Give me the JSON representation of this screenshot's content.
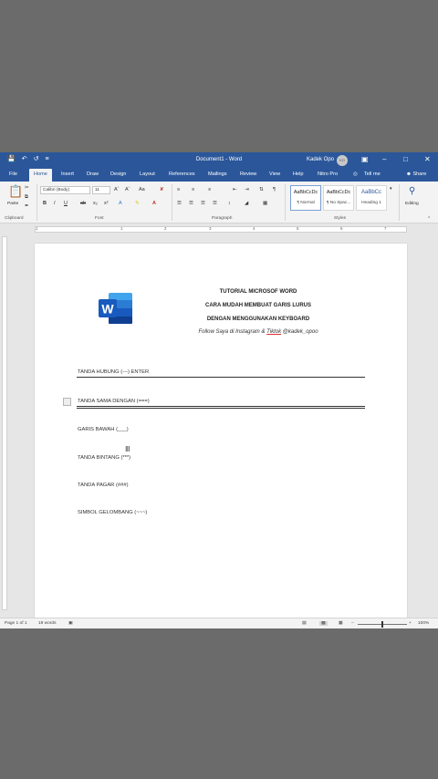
{
  "window": {
    "title": "Document1 - Word",
    "user": "Kadek Opo",
    "avatar_initials": "KO",
    "qa_icons": [
      "save-icon",
      "undo-icon",
      "redo-icon",
      "customize-icon"
    ]
  },
  "tabs": [
    "File",
    "Home",
    "Insert",
    "Draw",
    "Design",
    "Layout",
    "References",
    "Mailings",
    "Review",
    "View",
    "Help",
    "Nitro Pro"
  ],
  "tell_me": "Tell me",
  "share": "Share",
  "ribbon": {
    "paste": "Paste",
    "font_name": "Calibri (Body)",
    "font_size": "11",
    "styles": [
      {
        "preview": "AaBbCcDc",
        "name": "¶ Normal"
      },
      {
        "preview": "AaBbCcDc",
        "name": "¶ No Spac..."
      },
      {
        "preview": "AaBbCc",
        "name": "Heading 1"
      }
    ],
    "editing": "Editing",
    "groups": [
      "Clipboard",
      "Font",
      "Paragraph",
      "Styles"
    ]
  },
  "ruler_numbers": [
    "1",
    "1",
    "2",
    "3",
    "4",
    "5",
    "6",
    "7"
  ],
  "document": {
    "headings": [
      "TUTORIAL MICROSOF WORD",
      "CARA MUDAH MEMBUAT GARIS LURUS",
      "DENGAN MENGGUNAKAN KEYBOARD"
    ],
    "follow_pre": "Follow Saya di Instagram & ",
    "follow_tiktok": "Tiktok",
    "follow_post": " @kadek_opoo",
    "items": [
      "TANDA HUBUNG (---) ENTER",
      "TANDA SAMA DENGAN (===)",
      "GARIS BAWAH (___)",
      "TANDA BINTANG (***)",
      "TANDA PAGAR (###)",
      "SIMBOL GELOMBANG (~~~)"
    ]
  },
  "status": {
    "page": "Page 1 of 1",
    "words": "19 words",
    "zoom": "100%"
  },
  "colors": {
    "word_blue": "#2b579a",
    "ribbon_bg": "#f3f3f3",
    "desktop_bg": "#6b6b6b"
  }
}
